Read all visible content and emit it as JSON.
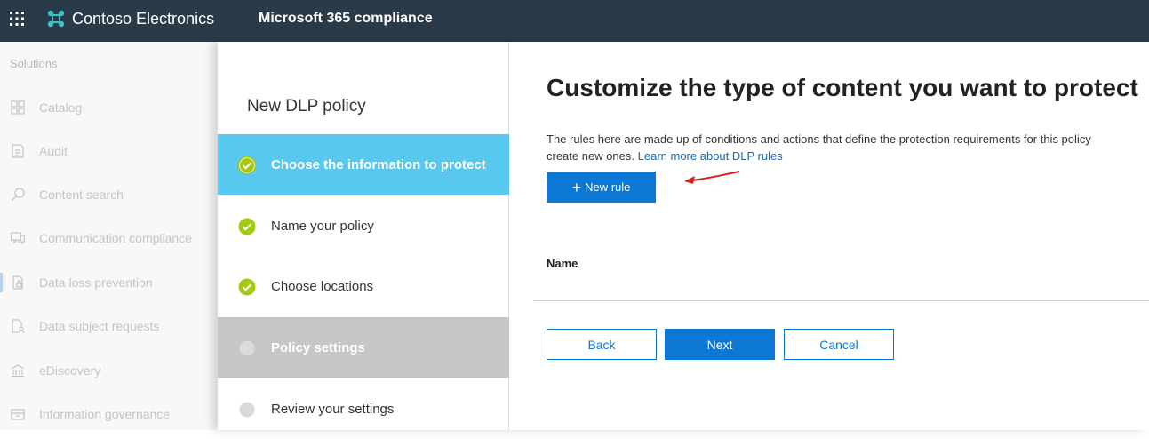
{
  "topbar": {
    "org_name": "Contoso Electronics",
    "app_title": "Microsoft 365 compliance"
  },
  "leftnav": {
    "header": "Solutions",
    "items": [
      {
        "label": "Catalog",
        "icon": "catalog-icon"
      },
      {
        "label": "Audit",
        "icon": "audit-icon"
      },
      {
        "label": "Content search",
        "icon": "search-icon"
      },
      {
        "label": "Communication compliance",
        "icon": "chat-icon"
      },
      {
        "label": "Data loss prevention",
        "icon": "document-lock-icon"
      },
      {
        "label": "Data subject requests",
        "icon": "document-person-icon"
      },
      {
        "label": "eDiscovery",
        "icon": "building-icon"
      },
      {
        "label": "Information governance",
        "icon": "governance-icon"
      }
    ]
  },
  "wizard": {
    "title": "New DLP policy",
    "steps": [
      {
        "label": "Choose the information to protect",
        "state": "current"
      },
      {
        "label": "Name your policy",
        "state": "done"
      },
      {
        "label": "Choose locations",
        "state": "done"
      },
      {
        "label": "Policy settings",
        "state": "inactive"
      },
      {
        "label": "Review your settings",
        "state": "pending"
      }
    ]
  },
  "content": {
    "heading": "Customize the type of content you want to protect",
    "description_line1": "The rules here are made up of conditions and actions that define the protection requirements for this policy",
    "description_line2": "create new ones.",
    "learn_more_link": "Learn more about DLP rules",
    "new_rule_label": "New rule",
    "table_column_name": "Name",
    "back_label": "Back",
    "next_label": "Next",
    "cancel_label": "Cancel"
  },
  "colors": {
    "topbar": "#2b3a48",
    "current_step": "#59c8ef",
    "inactive_step": "#c6c6c6",
    "check_green": "#a4c912",
    "primary": "#0a78d4",
    "annotation_arrow": "#d42020"
  }
}
